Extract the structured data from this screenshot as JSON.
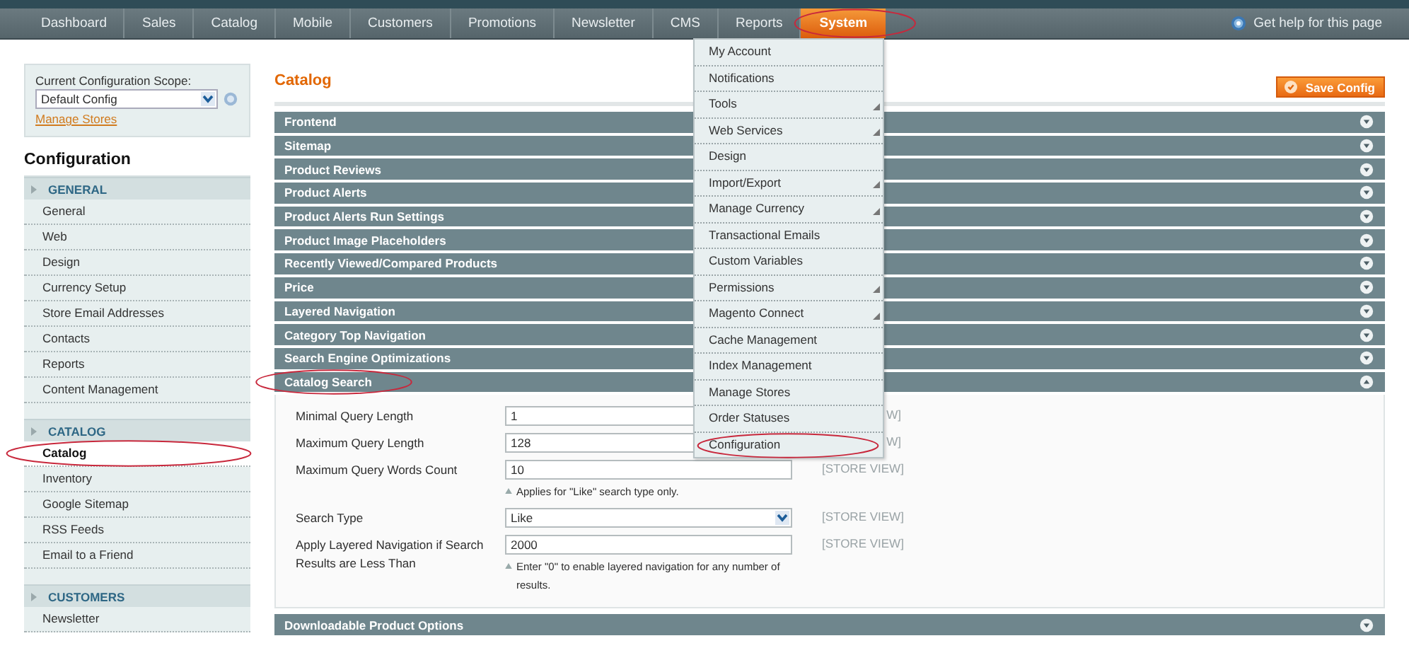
{
  "nav": {
    "items": [
      {
        "label": "Dashboard",
        "selected": false,
        "highlighted": false
      },
      {
        "label": "Sales",
        "selected": false,
        "highlighted": false
      },
      {
        "label": "Catalog",
        "selected": false,
        "highlighted": false
      },
      {
        "label": "Mobile",
        "selected": false,
        "highlighted": false
      },
      {
        "label": "Customers",
        "selected": false,
        "highlighted": false
      },
      {
        "label": "Promotions",
        "selected": false,
        "highlighted": false
      },
      {
        "label": "Newsletter",
        "selected": false,
        "highlighted": false
      },
      {
        "label": "CMS",
        "selected": false,
        "highlighted": false
      },
      {
        "label": "Reports",
        "selected": false,
        "highlighted": false
      },
      {
        "label": "System",
        "selected": true,
        "highlighted": true
      }
    ],
    "help": "Get help for this page"
  },
  "system_menu": [
    {
      "label": "My Account",
      "submenu": false,
      "highlighted": false
    },
    {
      "label": "Notifications",
      "submenu": false,
      "highlighted": false
    },
    {
      "label": "Tools",
      "submenu": true,
      "highlighted": false
    },
    {
      "label": "Web Services",
      "submenu": true,
      "highlighted": false
    },
    {
      "label": "Design",
      "submenu": false,
      "highlighted": false
    },
    {
      "label": "Import/Export",
      "submenu": true,
      "highlighted": false
    },
    {
      "label": "Manage Currency",
      "submenu": true,
      "highlighted": false
    },
    {
      "label": "Transactional Emails",
      "submenu": false,
      "highlighted": false
    },
    {
      "label": "Custom Variables",
      "submenu": false,
      "highlighted": false
    },
    {
      "label": "Permissions",
      "submenu": true,
      "highlighted": false
    },
    {
      "label": "Magento Connect",
      "submenu": true,
      "highlighted": false
    },
    {
      "label": "Cache Management",
      "submenu": false,
      "highlighted": false
    },
    {
      "label": "Index Management",
      "submenu": false,
      "highlighted": false
    },
    {
      "label": "Manage Stores",
      "submenu": false,
      "highlighted": false
    },
    {
      "label": "Order Statuses",
      "submenu": false,
      "highlighted": false
    },
    {
      "label": "Configuration",
      "submenu": false,
      "highlighted": true
    }
  ],
  "sidebar": {
    "scope_label": "Current Configuration Scope:",
    "scope_value": "Default Config",
    "manage_link": "Manage Stores",
    "title": "Configuration",
    "groups": [
      {
        "title": "GENERAL",
        "items": [
          {
            "label": "General",
            "selected": false,
            "highlighted": false
          },
          {
            "label": "Web",
            "selected": false,
            "highlighted": false
          },
          {
            "label": "Design",
            "selected": false,
            "highlighted": false
          },
          {
            "label": "Currency Setup",
            "selected": false,
            "highlighted": false
          },
          {
            "label": "Store Email Addresses",
            "selected": false,
            "highlighted": false
          },
          {
            "label": "Contacts",
            "selected": false,
            "highlighted": false
          },
          {
            "label": "Reports",
            "selected": false,
            "highlighted": false
          },
          {
            "label": "Content Management",
            "selected": false,
            "highlighted": false
          }
        ]
      },
      {
        "title": "CATALOG",
        "items": [
          {
            "label": "Catalog",
            "selected": true,
            "highlighted": true
          },
          {
            "label": "Inventory",
            "selected": false,
            "highlighted": false
          },
          {
            "label": "Google Sitemap",
            "selected": false,
            "highlighted": false
          },
          {
            "label": "RSS Feeds",
            "selected": false,
            "highlighted": false
          },
          {
            "label": "Email to a Friend",
            "selected": false,
            "highlighted": false
          }
        ]
      },
      {
        "title": "CUSTOMERS",
        "items": [
          {
            "label": "Newsletter",
            "selected": false,
            "highlighted": false
          }
        ]
      }
    ]
  },
  "main": {
    "title": "Catalog",
    "save_button": "Save Config",
    "sections": [
      {
        "title": "Frontend",
        "expanded": false,
        "highlighted": false
      },
      {
        "title": "Sitemap",
        "expanded": false,
        "highlighted": false
      },
      {
        "title": "Product Reviews",
        "expanded": false,
        "highlighted": false
      },
      {
        "title": "Product Alerts",
        "expanded": false,
        "highlighted": false
      },
      {
        "title": "Product Alerts Run Settings",
        "expanded": false,
        "highlighted": false
      },
      {
        "title": "Product Image Placeholders",
        "expanded": false,
        "highlighted": false
      },
      {
        "title": "Recently Viewed/Compared Products",
        "expanded": false,
        "highlighted": false
      },
      {
        "title": "Price",
        "expanded": false,
        "highlighted": false
      },
      {
        "title": "Layered Navigation",
        "expanded": false,
        "highlighted": false
      },
      {
        "title": "Category Top Navigation",
        "expanded": false,
        "highlighted": false
      },
      {
        "title": "Search Engine Optimizations",
        "expanded": false,
        "highlighted": false
      },
      {
        "title": "Catalog Search",
        "expanded": true,
        "highlighted": true,
        "fields": [
          {
            "kind": "text",
            "label": "Minimal Query Length",
            "value": "1",
            "scope": "W]"
          },
          {
            "kind": "text",
            "label": "Maximum Query Length",
            "value": "128",
            "scope": "W]"
          },
          {
            "kind": "text",
            "label": "Maximum Query Words Count",
            "value": "10",
            "scope": "[STORE VIEW]",
            "note": "Applies for \"Like\" search type only."
          },
          {
            "kind": "select",
            "label": "Search Type",
            "value": "Like",
            "scope": "[STORE VIEW]"
          },
          {
            "kind": "text",
            "label": "Apply Layered Navigation if Search Results are Less Than",
            "value": "2000",
            "scope": "[STORE VIEW]",
            "note": "Enter \"0\" to enable layered navigation for any number of results."
          }
        ]
      },
      {
        "title": "Downloadable Product Options",
        "expanded": false,
        "highlighted": false
      }
    ]
  }
}
